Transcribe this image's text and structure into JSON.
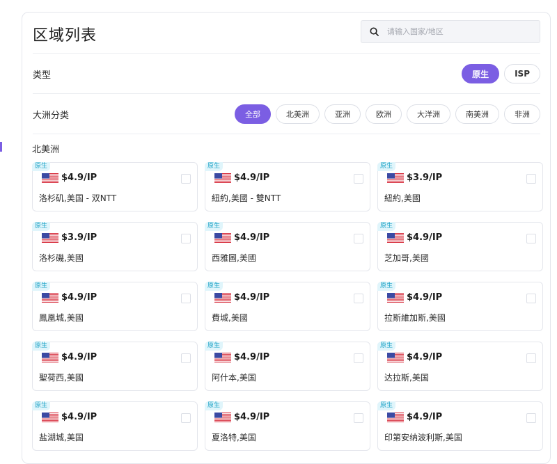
{
  "panel": {
    "title": "区域列表",
    "search": {
      "placeholder": "请输入国家/地区",
      "value": ""
    }
  },
  "filters": {
    "type": {
      "label": "类型",
      "options": [
        "原生",
        "ISP"
      ],
      "selected": "原生"
    },
    "continent": {
      "label": "大洲分类",
      "options": [
        "全部",
        "北美洲",
        "亚洲",
        "欧洲",
        "大洋洲",
        "南美洲",
        "非洲"
      ],
      "selected": "全部"
    }
  },
  "section": {
    "title": "北美洲",
    "accent_color": "#7b5ee3",
    "cards": [
      {
        "badge": "原生",
        "price": "$4.9/IP",
        "location": "洛杉矶,美国 - 双NTT",
        "flag": "us-flag-icon"
      },
      {
        "badge": "原生",
        "price": "$4.9/IP",
        "location": "紐約,美國 - 雙NTT",
        "flag": "us-flag-icon"
      },
      {
        "badge": "原生",
        "price": "$3.9/IP",
        "location": "紐約,美國",
        "flag": "us-flag-icon"
      },
      {
        "badge": "原生",
        "price": "$3.9/IP",
        "location": "洛杉磯,美國",
        "flag": "us-flag-icon"
      },
      {
        "badge": "原生",
        "price": "$4.9/IP",
        "location": "西雅圖,美國",
        "flag": "us-flag-icon"
      },
      {
        "badge": "原生",
        "price": "$4.9/IP",
        "location": "芝加哥,美國",
        "flag": "us-flag-icon"
      },
      {
        "badge": "原生",
        "price": "$4.9/IP",
        "location": "鳳凰城,美國",
        "flag": "us-flag-icon"
      },
      {
        "badge": "原生",
        "price": "$4.9/IP",
        "location": "費城,美國",
        "flag": "us-flag-icon"
      },
      {
        "badge": "原生",
        "price": "$4.9/IP",
        "location": "拉斯維加斯,美國",
        "flag": "us-flag-icon"
      },
      {
        "badge": "原生",
        "price": "$4.9/IP",
        "location": "聖荷西,美國",
        "flag": "us-flag-icon"
      },
      {
        "badge": "原生",
        "price": "$4.9/IP",
        "location": "阿什本,美国",
        "flag": "us-flag-icon"
      },
      {
        "badge": "原生",
        "price": "$4.9/IP",
        "location": "达拉斯,美国",
        "flag": "us-flag-icon"
      },
      {
        "badge": "原生",
        "price": "$4.9/IP",
        "location": "盐湖城,美国",
        "flag": "us-flag-icon"
      },
      {
        "badge": "原生",
        "price": "$4.9/IP",
        "location": "夏洛特,美国",
        "flag": "us-flag-icon"
      },
      {
        "badge": "原生",
        "price": "$4.9/IP",
        "location": "印第安纳波利斯,美国",
        "flag": "us-flag-icon"
      }
    ]
  }
}
